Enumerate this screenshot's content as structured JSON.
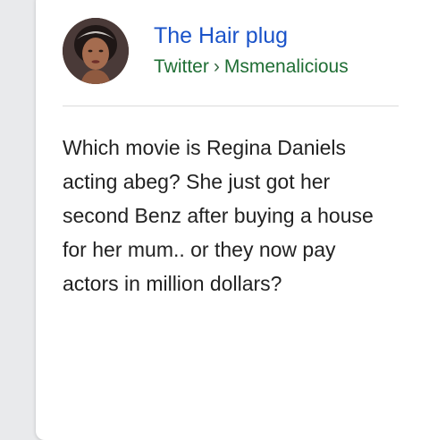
{
  "card": {
    "source_name": "The Hair plug",
    "platform": "Twitter",
    "separator": "›",
    "handle": "Msmenalicious",
    "avatar_icon": "profile-photo",
    "post_text": "Which movie is Regina Daniels acting abeg? She just got her second Benz after buying a house for her mum.. or they now pay actors in million dollars?"
  },
  "colors": {
    "source_name": "#1a53c9",
    "source_line": "#1f6e34",
    "text": "#222222"
  }
}
